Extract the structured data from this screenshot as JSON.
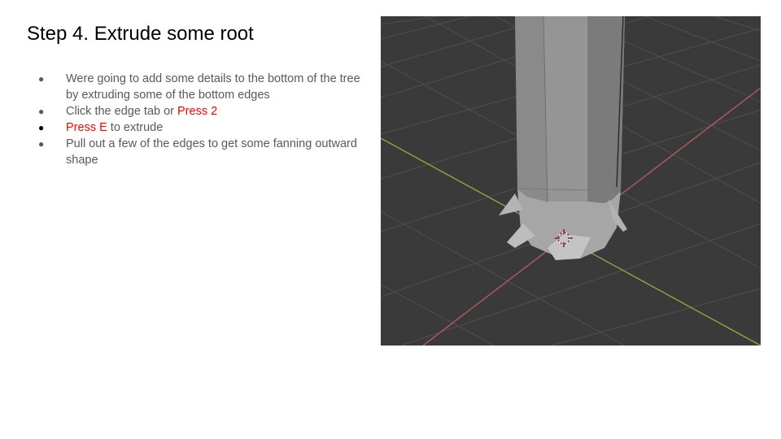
{
  "slide": {
    "title": "Step 4. Extrude some root",
    "bullets": [
      {
        "parts": [
          {
            "text": "Were going to add some details to the bottom of the tree by extruding some of the bottom edges",
            "highlight": false
          }
        ]
      },
      {
        "parts": [
          {
            "text": "Click the edge tab or ",
            "highlight": false
          },
          {
            "text": "Press 2",
            "highlight": true
          }
        ]
      },
      {
        "parts": [
          {
            "text": "Press E",
            "highlight": true
          },
          {
            "text": " to extrude",
            "highlight": false
          }
        ]
      },
      {
        "parts": [
          {
            "text": "Pull out a few of the edges to get some fanning outward shape",
            "highlight": false
          }
        ]
      }
    ],
    "bullet_symbol": "●",
    "highlight_color": "#ff0000",
    "text_color": "#595959"
  },
  "viewport": {
    "background_color": "#3a3a3a",
    "grid_color": "#4c4c4c",
    "x_axis_color": "#b05560",
    "y_axis_color": "#8aa040",
    "mesh_color": "#8c8c8c",
    "icons": [
      "3d-cursor-icon"
    ]
  }
}
